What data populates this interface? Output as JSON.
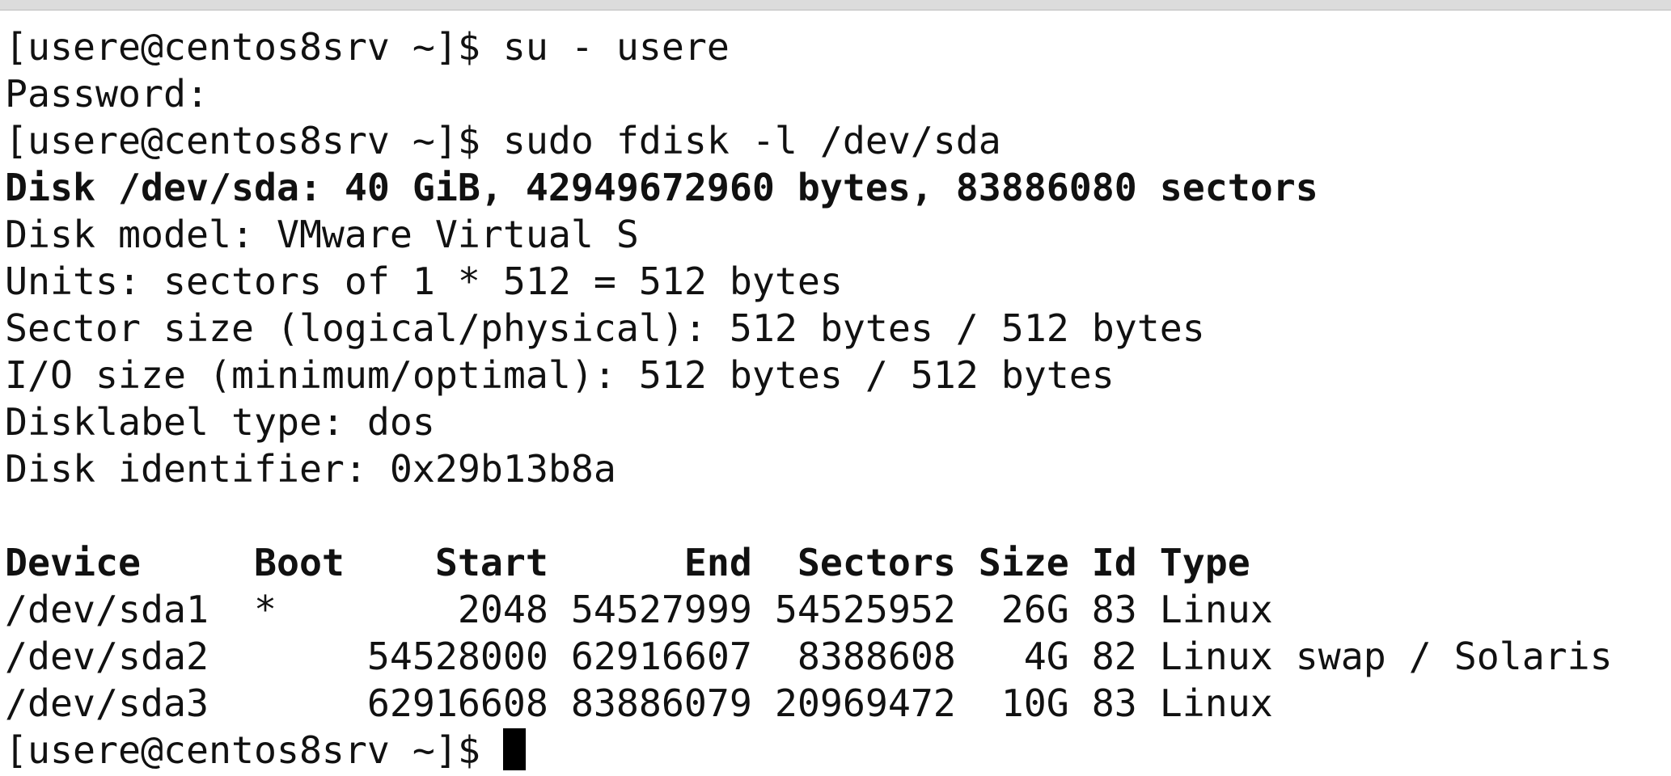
{
  "terminal": {
    "lines": {
      "l0": "[usere@centos8srv ~]$ su - usere",
      "l1": "Password:",
      "l2": "[usere@centos8srv ~]$ sudo fdisk -l /dev/sda",
      "l3": "Disk /dev/sda: 40 GiB, 42949672960 bytes, 83886080 sectors",
      "l4": "Disk model: VMware Virtual S",
      "l5": "Units: sectors of 1 * 512 = 512 bytes",
      "l6": "Sector size (logical/physical): 512 bytes / 512 bytes",
      "l7": "I/O size (minimum/optimal): 512 bytes / 512 bytes",
      "l8": "Disklabel type: dos",
      "l9": "Disk identifier: 0x29b13b8a",
      "l10": "",
      "l11": "Device     Boot    Start      End  Sectors Size Id Type",
      "l12": "/dev/sda1  *        2048 54527999 54525952  26G 83 Linux",
      "l13": "/dev/sda2       54528000 62916607  8388608   4G 82 Linux swap / Solaris",
      "l14": "/dev/sda3       62916608 83886079 20969472  10G 83 Linux",
      "prompt": "[usere@centos8srv ~]$ "
    }
  }
}
